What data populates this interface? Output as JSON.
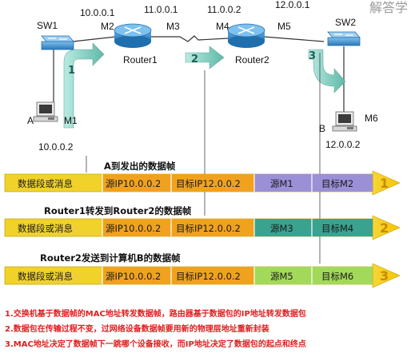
{
  "devices": {
    "sw1": "SW1",
    "sw2": "SW2",
    "router1": "Router1",
    "router2": "Router2",
    "host_a": "A",
    "host_b": "B"
  },
  "ports": {
    "m1": "M1",
    "m2": "M2",
    "m3": "M3",
    "m4": "M4",
    "m5": "M5",
    "m6": "M6"
  },
  "addresses": {
    "ip_m2": "10.0.0.1",
    "ip_m3": "11.0.0.1",
    "ip_m4": "11.0.0.2",
    "ip_m5": "12.0.0.1",
    "ip_a": "10.0.0.2",
    "ip_b": "12.0.0.2"
  },
  "step_numbers": [
    "1",
    "2",
    "3"
  ],
  "frames": [
    {
      "caption": "A到发出的数据帧",
      "cells": [
        "数据段或消息",
        "源IP10.0.0.2",
        "目标IP12.0.0.2",
        "源M1",
        "目标M2"
      ],
      "number": "1",
      "mac_color": "#9b8fd6"
    },
    {
      "caption": "Router1转发到Router2的数据帧",
      "cells": [
        "数据段或消息",
        "源IP10.0.0.2",
        "目标IP12.0.0.2",
        "源M3",
        "目标M4"
      ],
      "number": "2",
      "mac_color": "#3aa38f"
    },
    {
      "caption": "Router2发送到计算机B的数据帧",
      "cells": [
        "数据段或消息",
        "源IP10.0.0.2",
        "目标IP12.0.0.2",
        "源M5",
        "目标M6"
      ],
      "number": "3",
      "mac_color": "#a3d95a"
    }
  ],
  "notes": [
    "1.交换机基于数据帧的MAC地址转发数据帧，路由器基于数据包的IP地址转发数据包",
    "2.数据包在传输过程不变，过网络设备数据帧要用新的物理层地址重新封装",
    "3.MAC地址决定了数据帧下一跳哪个设备接收，而IP地址决定了数据包的起点和终点"
  ],
  "watermark": "解答学",
  "colors": {
    "cell_yellow": "#f0d22a",
    "ip_orange": "#f0a21e",
    "note_red": "#e02020",
    "router_blue": "#2f86c9",
    "arrow_green": "#8ed3c7"
  }
}
